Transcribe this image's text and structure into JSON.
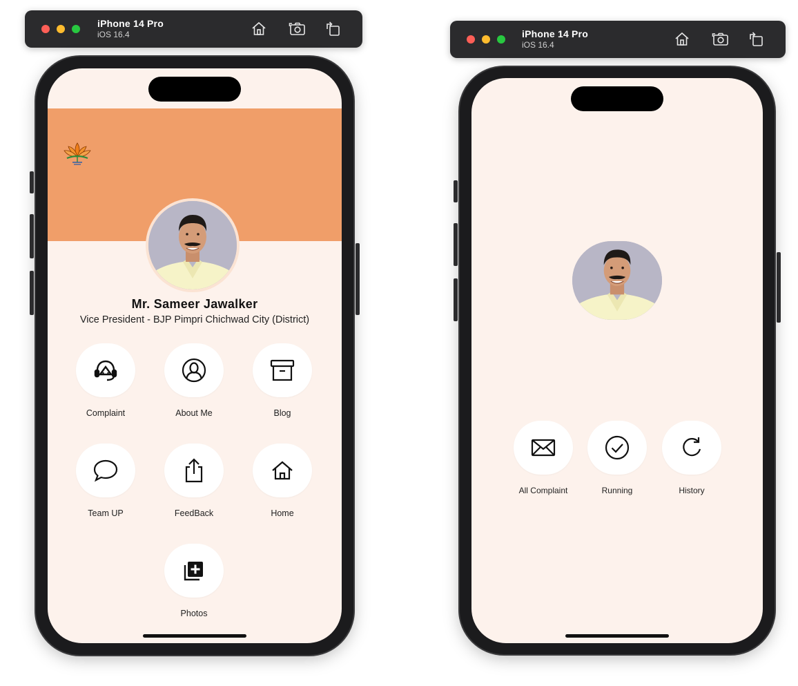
{
  "simulators": [
    {
      "device_name": "iPhone 14 Pro",
      "os_version": "iOS 16.4",
      "toolbar_icons": [
        "home-icon",
        "screenshot-icon",
        "rotate-icon"
      ]
    },
    {
      "device_name": "iPhone 14 Pro",
      "os_version": "iOS 16.4",
      "toolbar_icons": [
        "home-icon",
        "screenshot-icon",
        "rotate-icon"
      ]
    }
  ],
  "profile": {
    "name": "Mr. Sameer Jawalker",
    "role": "Vice President - BJP Pimpri Chichwad City (District)",
    "logo_icon": "bjp-lotus-logo",
    "header_color": "#f09e69",
    "background_color": "#fdf2ec"
  },
  "menu": [
    {
      "label": "Complaint",
      "icon": "headset-icon"
    },
    {
      "label": "About Me",
      "icon": "user-circle-icon"
    },
    {
      "label": "Blog",
      "icon": "archive-box-icon"
    },
    {
      "label": "Team UP",
      "icon": "chat-bubble-icon"
    },
    {
      "label": "FeedBack",
      "icon": "share-icon"
    },
    {
      "label": "Home",
      "icon": "home-icon"
    },
    {
      "label": "Photos",
      "icon": "add-photo-icon"
    }
  ],
  "complaint_menu": [
    {
      "label": "All Complaint",
      "icon": "mail-icon"
    },
    {
      "label": "Running",
      "icon": "check-circle-icon"
    },
    {
      "label": "History",
      "icon": "refresh-icon"
    }
  ]
}
